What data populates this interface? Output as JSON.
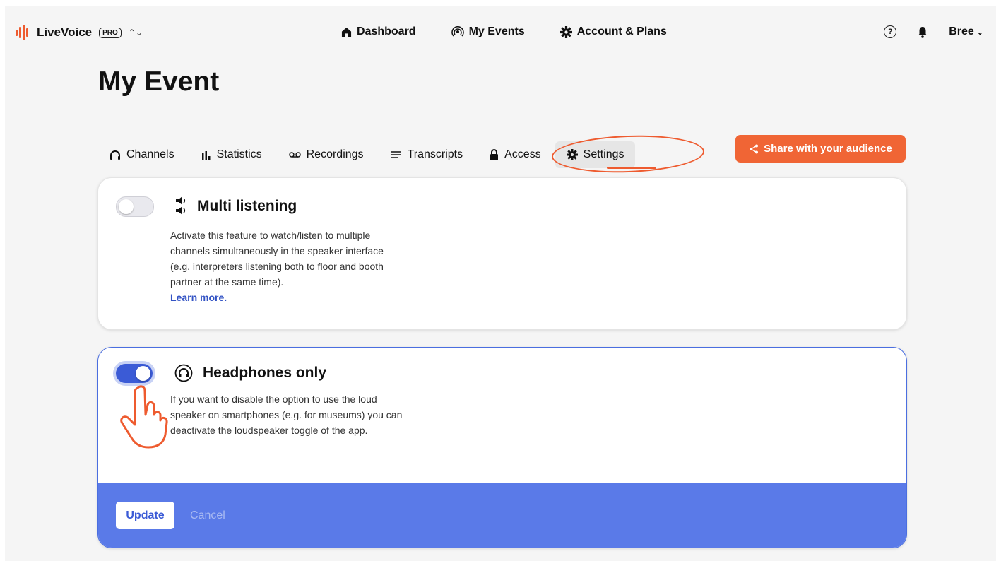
{
  "app": {
    "name": "LiveVoice",
    "plan_badge": "PRO",
    "logo_icon": "audio-bars-icon",
    "brand_color": "#ee5b2f"
  },
  "nav": {
    "items": [
      {
        "label": "Dashboard",
        "icon": "home-icon"
      },
      {
        "label": "My Events",
        "icon": "broadcast-icon"
      },
      {
        "label": "Account & Plans",
        "icon": "gear-icon"
      }
    ],
    "help_icon": "question-circle-icon",
    "notification_icon": "bell-icon",
    "user_name": "Bree"
  },
  "page": {
    "title": "My Event"
  },
  "tabs": [
    {
      "label": "Channels",
      "icon": "headphones-icon",
      "active": false
    },
    {
      "label": "Statistics",
      "icon": "bar-chart-icon",
      "active": false
    },
    {
      "label": "Recordings",
      "icon": "voicemail-icon",
      "active": false
    },
    {
      "label": "Transcripts",
      "icon": "lines-icon",
      "active": false
    },
    {
      "label": "Access",
      "icon": "lock-icon",
      "active": false
    },
    {
      "label": "Settings",
      "icon": "gear-icon",
      "active": true
    }
  ],
  "share_button": {
    "label": "Share with your audience",
    "icon": "share-icon",
    "color": "#f06535"
  },
  "settings": [
    {
      "title": "Multi listening",
      "icon": "speakers-icon",
      "enabled": false,
      "description": "Activate this feature to watch/listen to multiple channels simultaneously in the speaker interface (e.g. interpreters listening both to floor and booth partner at the same time).",
      "link": "Learn more."
    },
    {
      "title": "Headphones only",
      "icon": "headphones-circle-icon",
      "enabled": true,
      "description": "If you want to disable the option to use the loud speaker on smartphones (e.g. for museums) you can deactivate the loudspeaker toggle of the app."
    }
  ],
  "footer": {
    "update_label": "Update",
    "cancel_label": "Cancel",
    "color": "#5a7ae8"
  },
  "accent_color": "#3b5bd6"
}
